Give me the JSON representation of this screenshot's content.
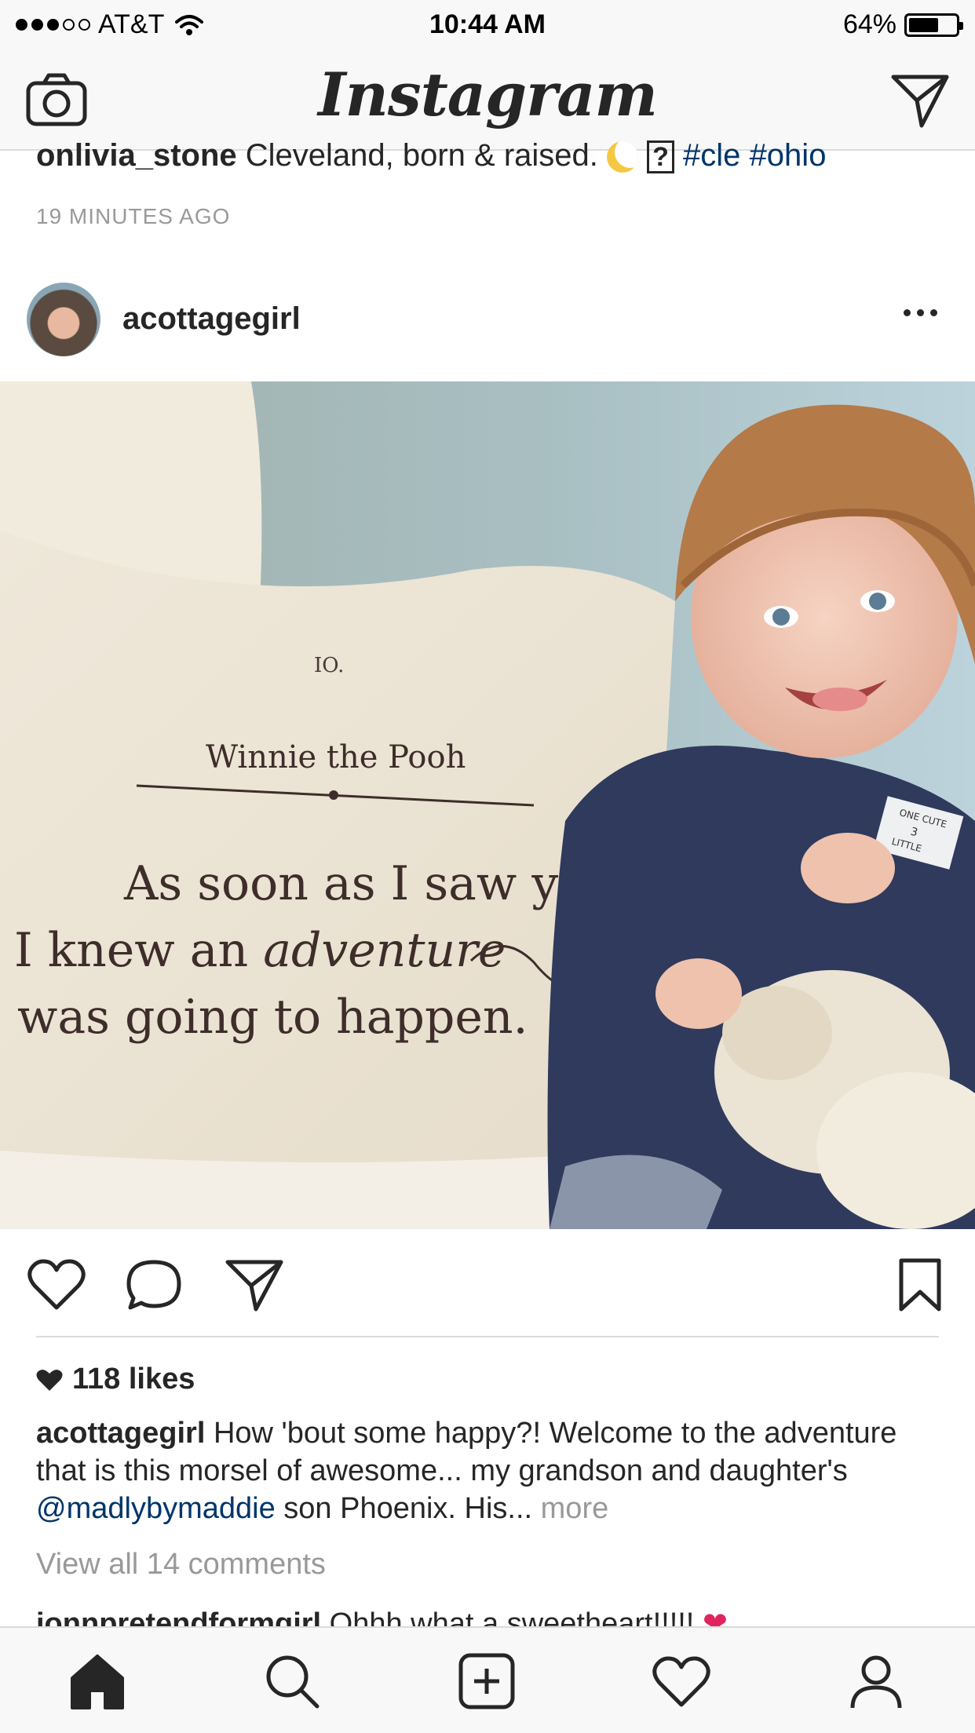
{
  "status_bar": {
    "carrier": "AT&T",
    "time": "10:44 AM",
    "battery": "64%",
    "battery_level": 0.64,
    "signal_bars_filled": 3,
    "signal_bars_total": 5
  },
  "nav": {
    "logo": "Instagram",
    "left_icon": "camera-icon",
    "right_icon": "direct-message-icon"
  },
  "previous_post": {
    "username": "onlivia_stone",
    "caption": "Cleveland, born & raised.",
    "unknown_glyph": "?",
    "hashtags": [
      "#cle",
      "#ohio"
    ],
    "timestamp": "19 MINUTES AGO"
  },
  "post": {
    "username": "acottagegirl",
    "photo": {
      "pillow_heading": "Winnie the Pooh",
      "pillow_top_fragment": "IO.",
      "quote_line1": "As soon as I saw yo",
      "quote_line2_start": "I knew an ",
      "quote_line2_italic": "adventure",
      "quote_line3": "was going to happen.",
      "tag_line1": "ONE CUTE",
      "tag_line2": "3",
      "tag_line3": "LITTLE"
    },
    "likes": "118 likes",
    "caption_username": "acottagegirl",
    "caption_text_1": " How 'bout some happy?! Welcome to the adventure that is this morsel of awesome... my grandson and daughter's ",
    "caption_mention": "@madlybymaddie",
    "caption_text_2": " son Phoenix. His... ",
    "caption_more": "more",
    "view_comments": "View all 14 comments",
    "comment_username": "ionnpretendformgirl",
    "comment_text": " Ohhh what a sweetheart!!!!! ",
    "comment_emoji": "❤"
  },
  "tab_bar": {
    "items": [
      "home-icon",
      "search-icon",
      "new-post-icon",
      "activity-icon",
      "profile-icon"
    ]
  },
  "colors": {
    "link": "#003569",
    "muted": "#999999",
    "text": "#262626",
    "bar_bg": "#f8f8f8",
    "divider": "#dbdbdb"
  }
}
